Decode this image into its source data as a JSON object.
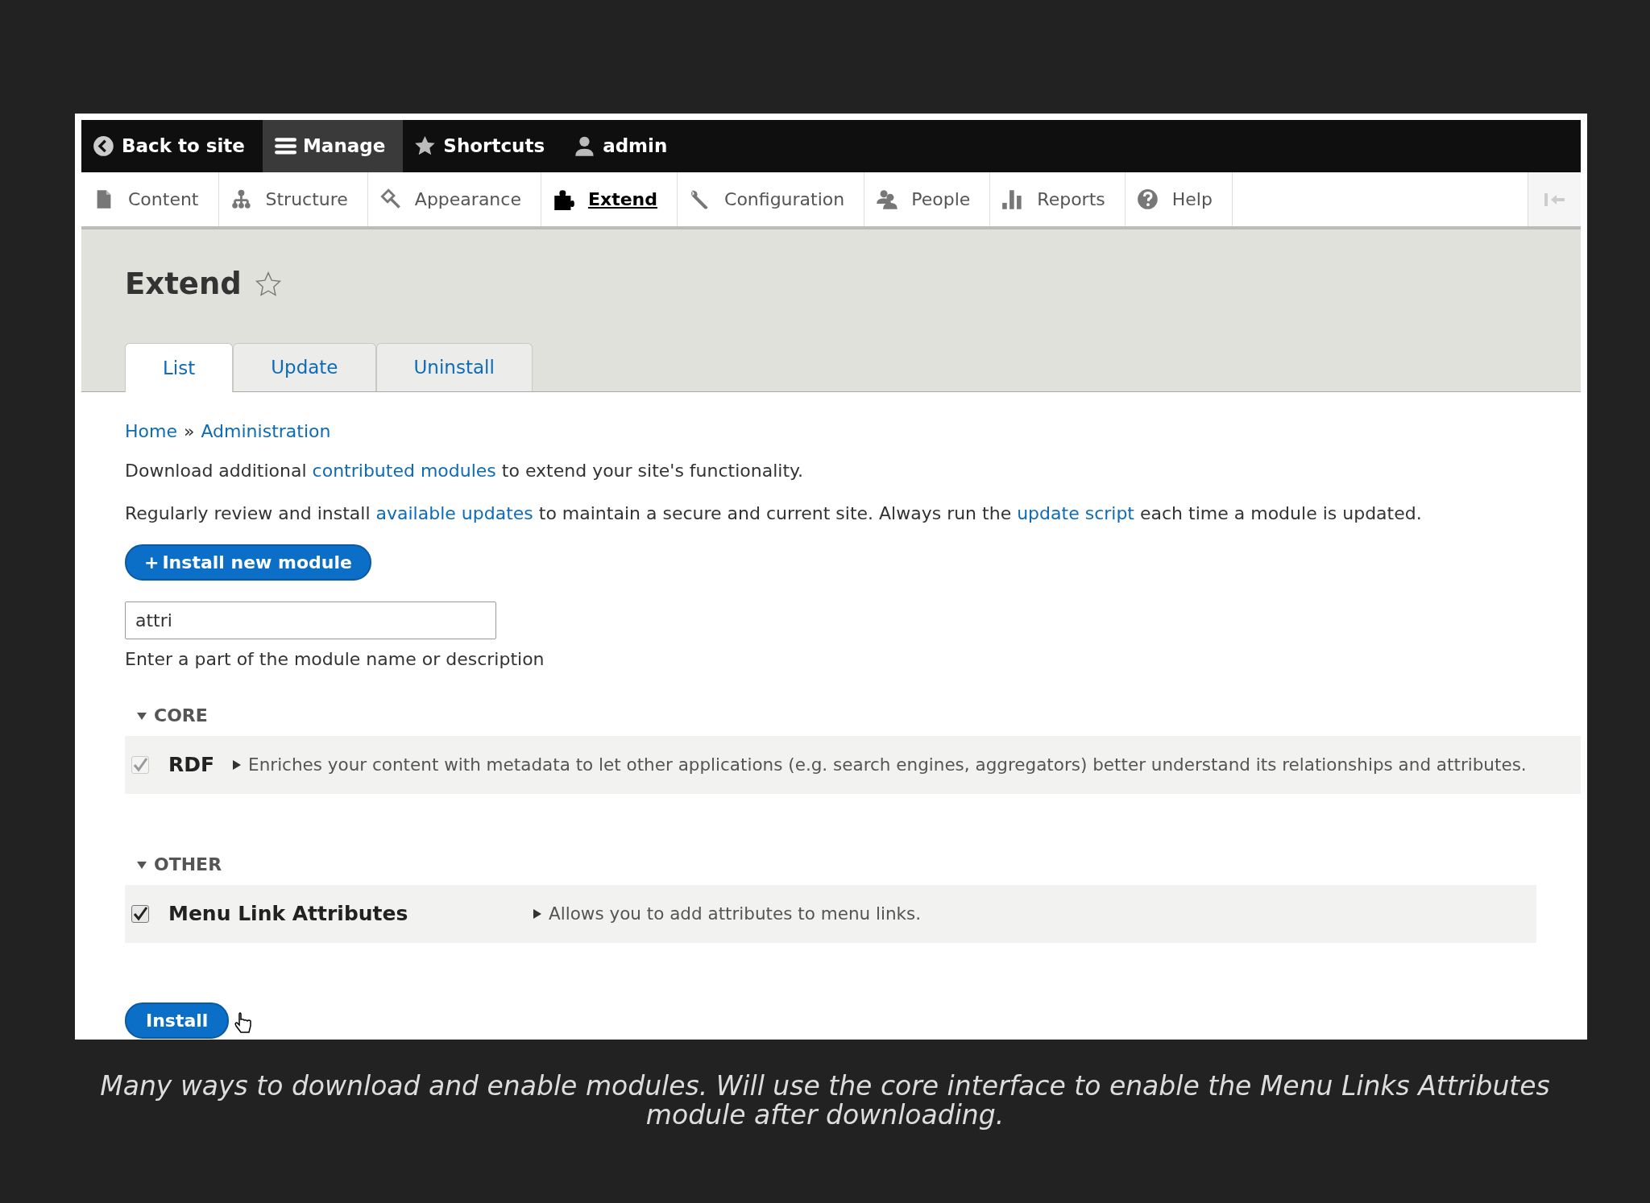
{
  "toolbar": {
    "items": [
      {
        "label": "Back to site",
        "selected": false
      },
      {
        "label": "Manage",
        "selected": true
      },
      {
        "label": "Shortcuts",
        "selected": false
      },
      {
        "label": "admin",
        "selected": false
      }
    ]
  },
  "admin_menu": {
    "items": [
      {
        "label": "Content",
        "selected": false
      },
      {
        "label": "Structure",
        "selected": false
      },
      {
        "label": "Appearance",
        "selected": false
      },
      {
        "label": "Extend",
        "selected": true
      },
      {
        "label": "Configuration",
        "selected": false
      },
      {
        "label": "People",
        "selected": false
      },
      {
        "label": "Reports",
        "selected": false
      },
      {
        "label": "Help",
        "selected": false
      }
    ]
  },
  "page": {
    "title": "Extend",
    "shortcut_starred": false
  },
  "tabs": [
    {
      "label": "List",
      "selected": true
    },
    {
      "label": "Update",
      "selected": false
    },
    {
      "label": "Uninstall",
      "selected": false
    }
  ],
  "breadcrumb": [
    {
      "label": "Home"
    },
    {
      "label": "Administration"
    }
  ],
  "breadcrumb_separator": "»",
  "paragraphs": [
    [
      {
        "text": "Download additional ",
        "link": false
      },
      {
        "text": "contributed modules",
        "link": true
      },
      {
        "text": " to extend your site's functionality.",
        "link": false
      }
    ],
    [
      {
        "text": "Regularly review and install ",
        "link": false
      },
      {
        "text": "available updates",
        "link": true
      },
      {
        "text": " to maintain a secure and current site. Always run the ",
        "link": false
      },
      {
        "text": "update script",
        "link": true
      },
      {
        "text": " each time a module is updated.",
        "link": false
      }
    ]
  ],
  "install_new_button": {
    "icon_text": "+",
    "label": "Install new module"
  },
  "filter": {
    "value": "attri",
    "description": "Enter a part of the module name or description"
  },
  "groups": [
    {
      "title": "CORE",
      "expanded": true,
      "modules": [
        {
          "name": "RDF",
          "checked": true,
          "disabled": true,
          "description": "Enriches your content with metadata to let other applications (e.g. search engines, aggregators) better understand its relationships and attributes."
        }
      ]
    },
    {
      "title": "OTHER",
      "expanded": true,
      "modules": [
        {
          "name": "Menu Link Attributes",
          "checked": true,
          "disabled": false,
          "description": "Allows you to add attributes to menu links."
        }
      ]
    }
  ],
  "install_button": {
    "label": "Install"
  },
  "caption": "Many ways to download and enable modules. Will use the core interface to enable the Menu Links Attributes module after downloading."
}
